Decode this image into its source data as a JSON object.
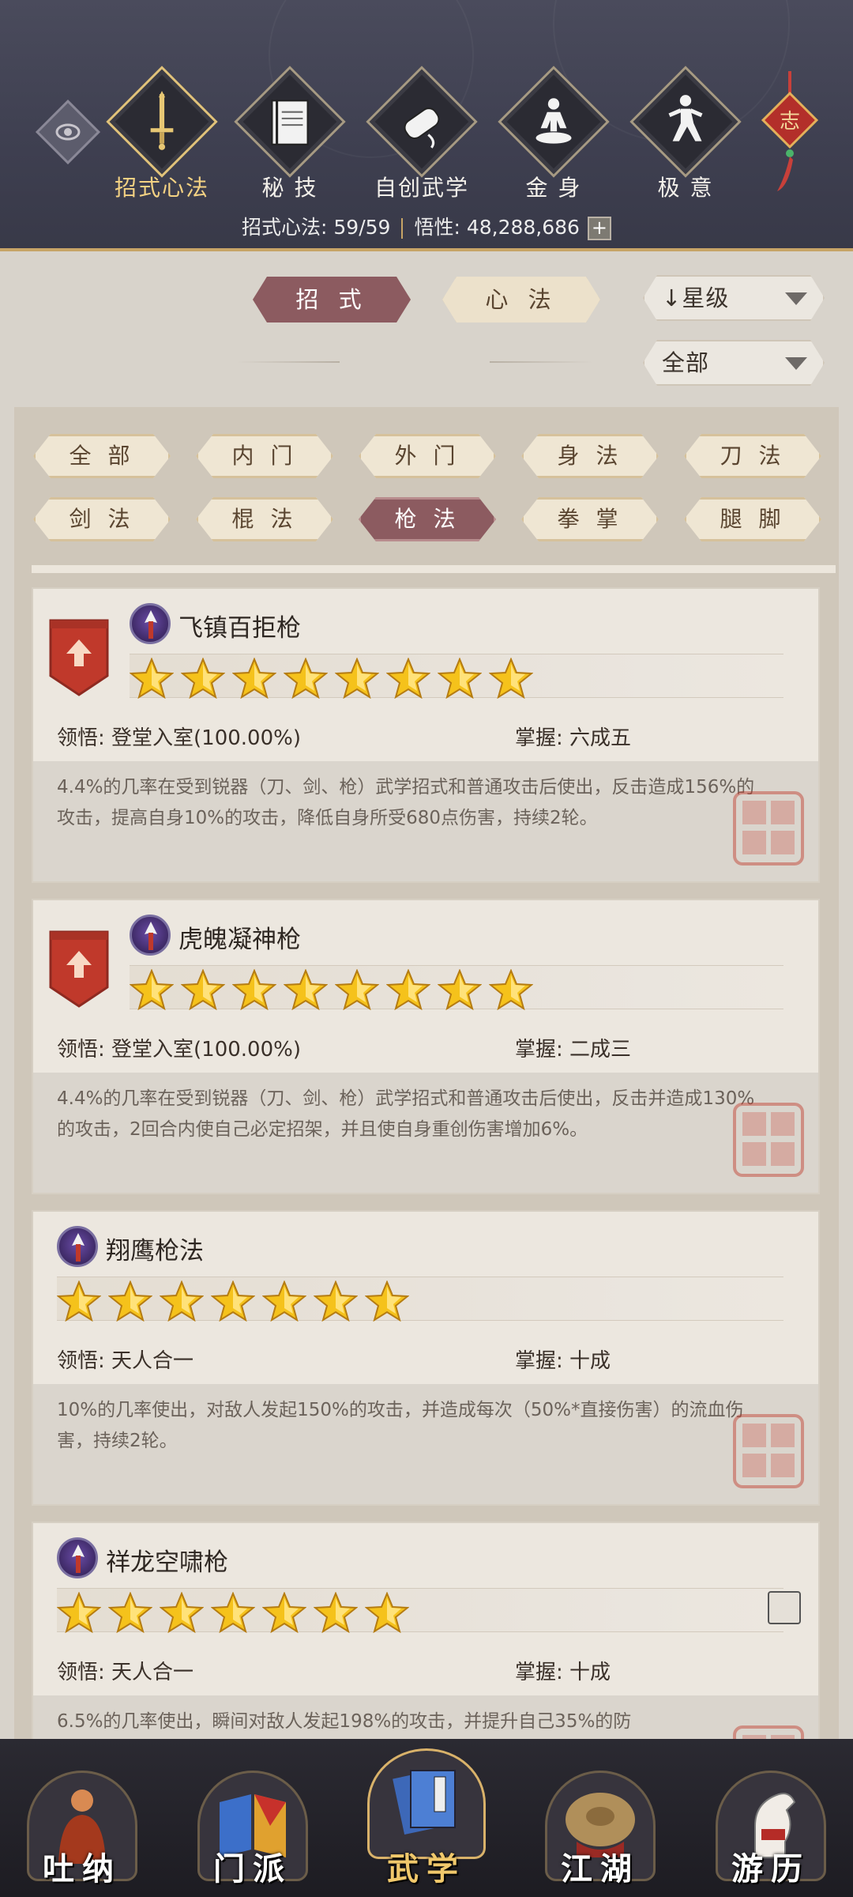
{
  "header": {
    "categories": [
      {
        "label": "招式心法",
        "icon": "sword-icon",
        "active": true
      },
      {
        "label": "秘 技",
        "icon": "book-icon",
        "active": false
      },
      {
        "label": "自创武学",
        "icon": "scroll-icon",
        "active": false
      },
      {
        "label": "金 身",
        "icon": "meditation-icon",
        "active": false
      },
      {
        "label": "极 意",
        "icon": "martial-pose-icon",
        "active": false
      }
    ],
    "knot_text": "志",
    "stats": {
      "count_label": "招式心法: 59/59",
      "insight_label": "悟性: 48,288,686",
      "plus": "+"
    }
  },
  "tabs": {
    "moves": "招 式",
    "mind": "心 法",
    "sort": "星级",
    "sort_arrow": "↓",
    "filter_all": "全部"
  },
  "filters": [
    {
      "label": "全 部",
      "active": false
    },
    {
      "label": "内 门",
      "active": false
    },
    {
      "label": "外 门",
      "active": false
    },
    {
      "label": "身 法",
      "active": false
    },
    {
      "label": "刀 法",
      "active": false
    },
    {
      "label": "剑 法",
      "active": false
    },
    {
      "label": "棍 法",
      "active": false
    },
    {
      "label": "枪 法",
      "active": true
    },
    {
      "label": "拳 掌",
      "active": false
    },
    {
      "label": "腿 脚",
      "active": false
    }
  ],
  "skills": [
    {
      "name": "飞镇百拒枪",
      "stars": 8,
      "upgrade": true,
      "lingwu": "领悟: 登堂入室(100.00%)",
      "zhangwo": "掌握: 六成五",
      "desc": "4.4%的几率在受到锐器（刀、剑、枪）武学招式和普通攻击后使出，反击造成156%的攻击，提高自身10%的攻击，降低自身所受680点伤害，持续2轮。"
    },
    {
      "name": "虎魄凝神枪",
      "stars": 8,
      "upgrade": true,
      "lingwu": "领悟: 登堂入室(100.00%)",
      "zhangwo": "掌握: 二成三",
      "desc": "4.4%的几率在受到锐器（刀、剑、枪）武学招式和普通攻击后使出，反击并造成130%的攻击，2回合内使自己必定招架，并且使自身重创伤害增加6%。"
    },
    {
      "name": "翔鹰枪法",
      "stars": 7,
      "upgrade": false,
      "lingwu": "领悟: 天人合一",
      "zhangwo": "掌握: 十成",
      "desc": "10%的几率使出，对敌人发起150%的攻击，并造成每次（50%*直接伤害）的流血伤害，持续2轮。"
    },
    {
      "name": "祥龙空啸枪",
      "stars": 7,
      "upgrade": false,
      "lingwu": "领悟: 天人合一",
      "zhangwo": "掌握: 十成",
      "desc": "6.5%的几率使出，瞬间对敌人发起198%的攻击，并提升自己35%的防"
    }
  ],
  "bottom_nav": [
    {
      "label": "吐纳",
      "icon": "monk-icon",
      "active": false
    },
    {
      "label": "门派",
      "icon": "sect-flag-icon",
      "active": false
    },
    {
      "label": "武学",
      "icon": "martial-book-icon",
      "active": true
    },
    {
      "label": "江湖",
      "icon": "straw-hat-icon",
      "active": false
    },
    {
      "label": "游历",
      "icon": "white-horse-icon",
      "active": false
    }
  ]
}
